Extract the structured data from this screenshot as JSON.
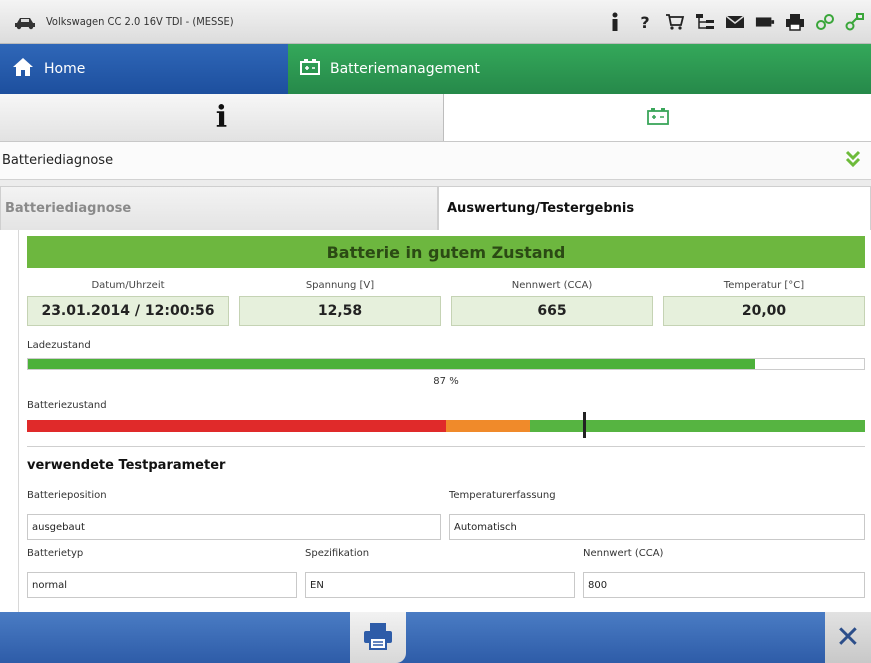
{
  "window": {
    "title": "Volkswagen CC 2.0 16V TDI - (MESSE)",
    "toolbar_icons": [
      "person-info-icon",
      "help-icon",
      "cart-icon",
      "tree-icon",
      "mail-icon",
      "battery-icon",
      "printer-icon",
      "link-icon",
      "connect-icon"
    ]
  },
  "nav": {
    "home_label": "Home",
    "module_label": "Batteriemanagement"
  },
  "main_tabs": {
    "info_glyph": "i"
  },
  "dropdown": {
    "value": "Batteriediagnose"
  },
  "sub_tabs": {
    "left": "Batteriediagnose",
    "right": "Auswertung/Testergebnis"
  },
  "result": {
    "status": "Batterie in gutem Zustand",
    "status_color": "#6db73f",
    "metrics": [
      {
        "label": "Datum/Uhrzeit",
        "value": "23.01.2014 / 12:00:56"
      },
      {
        "label": "Spannung [V]",
        "value": "12,58"
      },
      {
        "label": "Nennwert (CCA)",
        "value": "665"
      },
      {
        "label": "Temperatur [°C]",
        "value": "20,00"
      }
    ],
    "charge_label": "Ladezustand",
    "charge_percent_text": "87 %",
    "charge_fraction": 0.87,
    "health_label": "Batteriezustand",
    "health_segments": [
      {
        "color": "#e02a2a",
        "fraction": 0.5
      },
      {
        "color": "#f08a2a",
        "fraction": 0.1
      },
      {
        "color": "#56b441",
        "fraction": 0.4
      }
    ],
    "health_marker_fraction": 0.665
  },
  "params": {
    "title": "verwendete Testparameter",
    "battery_position_label": "Batterieposition",
    "battery_position_value": "ausgebaut",
    "temp_capture_label": "Temperaturerfassung",
    "temp_capture_value": "Automatisch",
    "battery_type_label": "Batterietyp",
    "battery_type_value": "normal",
    "spec_label": "Spezifikation",
    "spec_value": "EN",
    "cca_label": "Nennwert (CCA)",
    "cca_value": "800"
  },
  "bottom": {
    "close_glyph": "✕"
  }
}
